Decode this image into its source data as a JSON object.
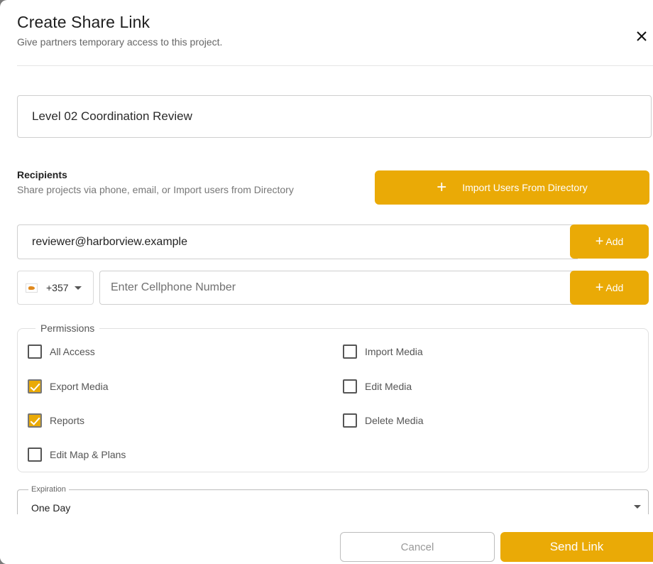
{
  "dialog": {
    "title": "Create Share Link",
    "subtitle": "Give partners temporary access to this project."
  },
  "link_name": {
    "value": "Level 02 Coordination Review"
  },
  "recipients": {
    "title": "Recipients",
    "subtitle": "Share projects via phone, email, or Import users from Directory",
    "import_button": {
      "icon": "+",
      "label": "Import Users From Directory"
    },
    "email": {
      "value": "reviewer@harborview.example"
    },
    "email_add": {
      "icon": "+",
      "label": "Add"
    },
    "phone": {
      "country_flag": "cyprus-flag-icon",
      "country_code": "+357",
      "placeholder": "Enter Cellphone Number",
      "value": ""
    },
    "phone_add": {
      "icon": "+",
      "label": "Add"
    }
  },
  "permissions": {
    "legend": "Permissions",
    "items": [
      {
        "label": "All Access",
        "checked": false
      },
      {
        "label": "Import Media",
        "checked": false
      },
      {
        "label": "Export Media",
        "checked": true
      },
      {
        "label": "Edit Media",
        "checked": false
      },
      {
        "label": "Reports",
        "checked": true
      },
      {
        "label": "Delete Media",
        "checked": false
      },
      {
        "label": "Edit Map & Plans",
        "checked": false
      }
    ]
  },
  "expiration": {
    "legend": "Expiration",
    "value": "One Day"
  },
  "footer": {
    "cancel_label": "Cancel",
    "send_label": "Send Link"
  },
  "colors": {
    "accent": "#eaaa06"
  }
}
